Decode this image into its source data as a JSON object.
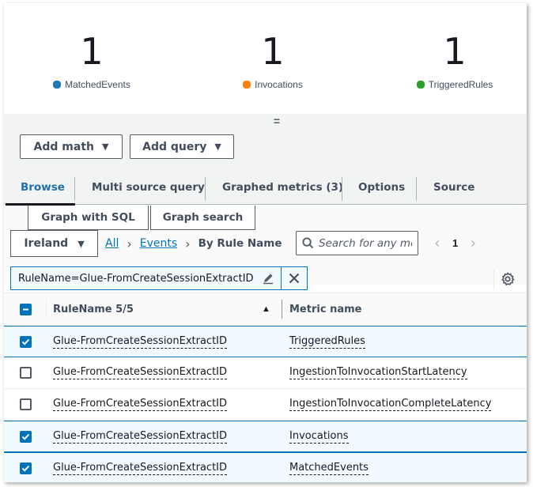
{
  "metrics": [
    {
      "value": "1",
      "label": "MatchedEvents",
      "color": "#1f77b4"
    },
    {
      "value": "1",
      "label": "Invocations",
      "color": "#ff7f0e"
    },
    {
      "value": "1",
      "label": "TriggeredRules",
      "color": "#2ca02c"
    }
  ],
  "toolbar": {
    "add_math": "Add math",
    "add_query": "Add query"
  },
  "tabs": [
    {
      "label": "Browse",
      "active": true
    },
    {
      "label": "Multi source query"
    },
    {
      "label": "Graphed metrics (3)"
    },
    {
      "label": "Options"
    },
    {
      "label": "Source"
    }
  ],
  "browse": {
    "graph_with_sql": "Graph with SQL",
    "graph_search": "Graph search",
    "region": "Ireland",
    "breadcrumb": {
      "all": "All",
      "events": "Events",
      "current": "By Rule Name"
    },
    "search_placeholder": "Search for any me",
    "page": "1",
    "filter": "RuleName=Glue-FromCreateSessionExtractID"
  },
  "table": {
    "header": {
      "rule_name": "RuleName 5/5",
      "metric_name": "Metric name"
    },
    "rows": [
      {
        "rule": "Glue-FromCreateSessionExtractID",
        "metric": "TriggeredRules",
        "checked": true
      },
      {
        "rule": "Glue-FromCreateSessionExtractID",
        "metric": "IngestionToInvocationStartLatency",
        "checked": false
      },
      {
        "rule": "Glue-FromCreateSessionExtractID",
        "metric": "IngestionToInvocationCompleteLatency",
        "checked": false
      },
      {
        "rule": "Glue-FromCreateSessionExtractID",
        "metric": "Invocations",
        "checked": true
      },
      {
        "rule": "Glue-FromCreateSessionExtractID",
        "metric": "MatchedEvents",
        "checked": true
      }
    ]
  }
}
